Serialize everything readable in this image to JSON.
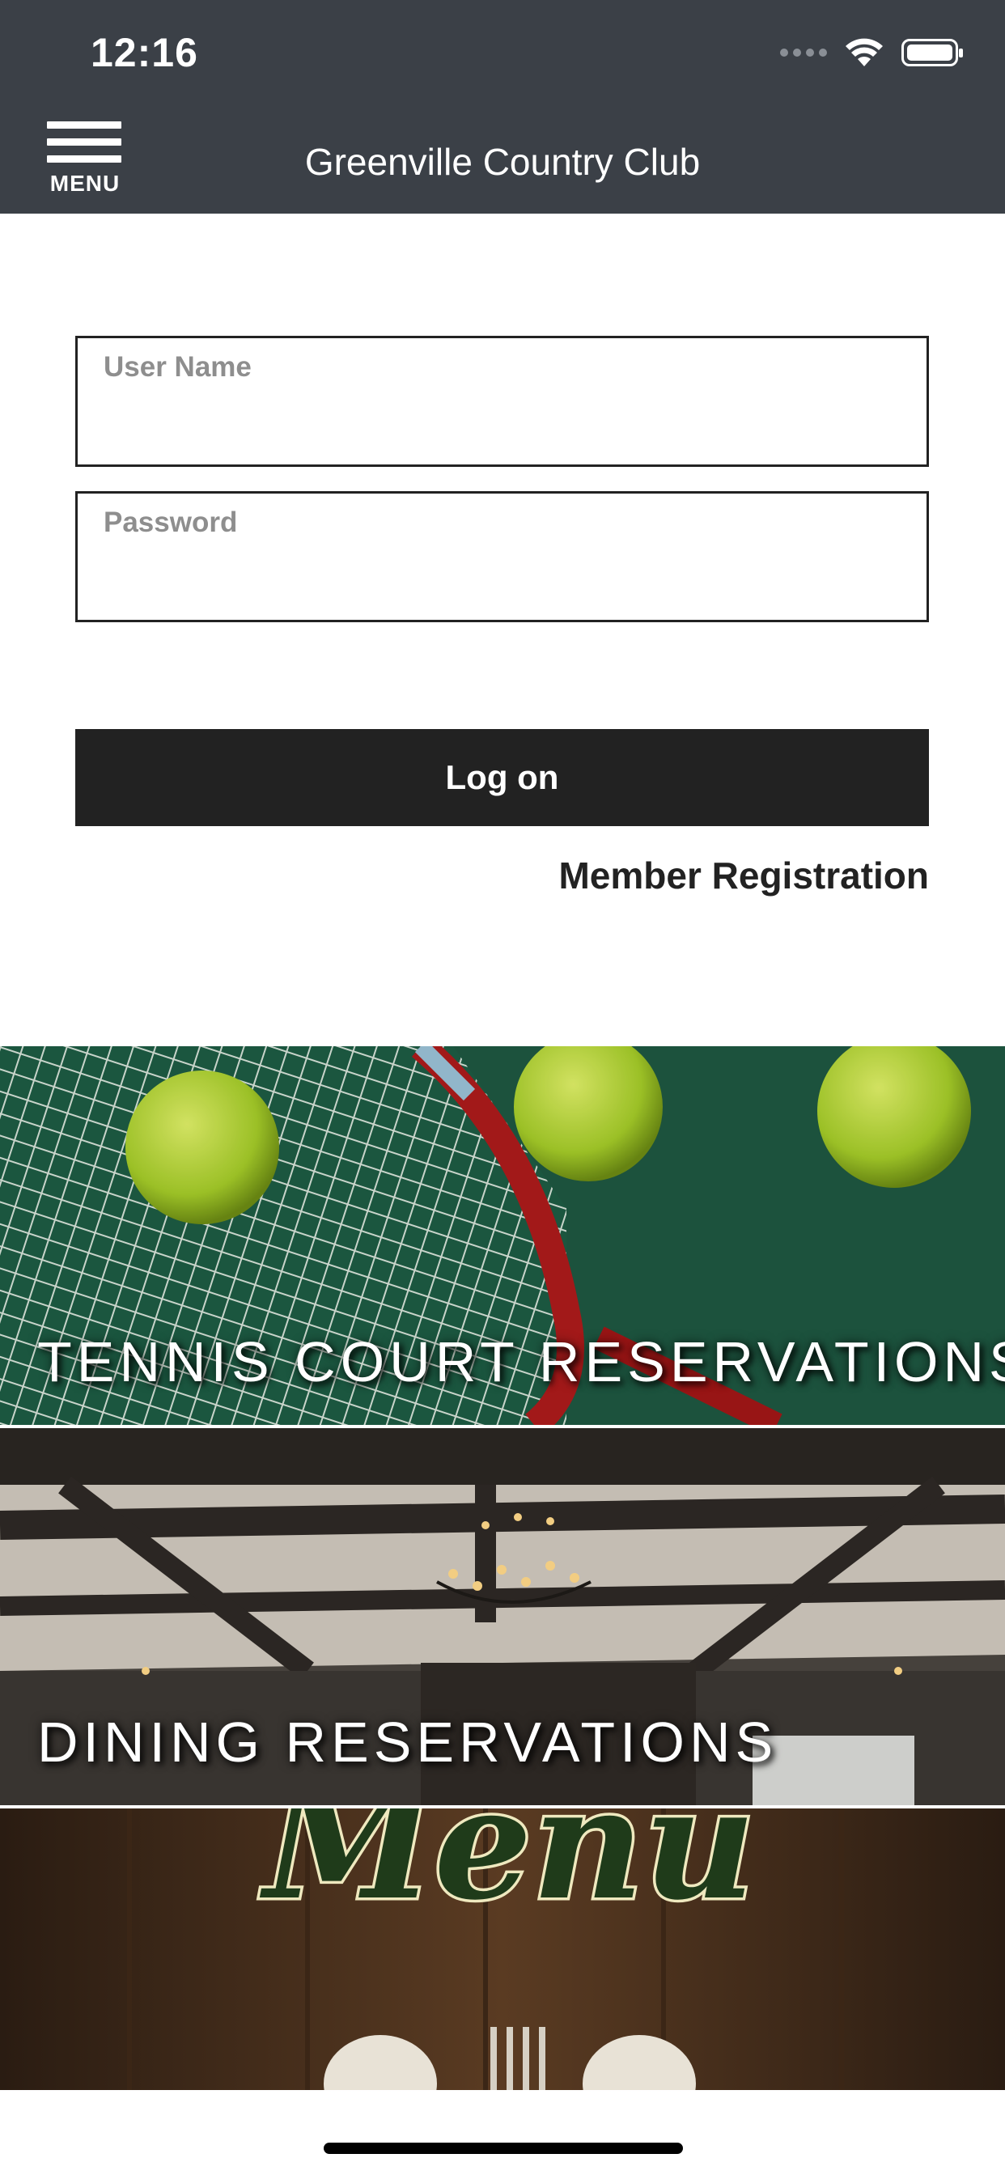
{
  "status_bar": {
    "time": "12:16"
  },
  "header": {
    "menu_label": "MENU",
    "title": "Greenville Country Club"
  },
  "login": {
    "username_placeholder": "User Name",
    "password_placeholder": "Password",
    "logon_label": "Log on",
    "member_registration_label": "Member Registration"
  },
  "tiles": [
    {
      "label": "TENNIS COURT RESERVATIONS"
    },
    {
      "label": "DINING RESERVATIONS"
    },
    {
      "label": "",
      "image_text": "Menu"
    }
  ],
  "colors": {
    "header_bg": "#3b4047",
    "button_bg": "#222222",
    "placeholder": "#8e8e8e"
  }
}
